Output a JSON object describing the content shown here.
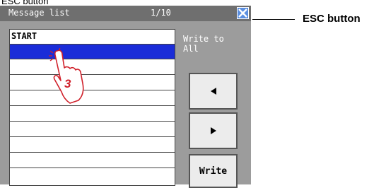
{
  "top_caption": "ESC button",
  "window": {
    "title": "Message list",
    "page_indicator": "1/10"
  },
  "list": {
    "rows": [
      {
        "text": "START",
        "selected": false
      },
      {
        "text": "",
        "selected": true
      },
      {
        "text": "",
        "selected": false
      },
      {
        "text": "",
        "selected": false
      },
      {
        "text": "",
        "selected": false
      },
      {
        "text": "",
        "selected": false
      },
      {
        "text": "",
        "selected": false
      },
      {
        "text": "",
        "selected": false
      },
      {
        "text": "",
        "selected": false
      },
      {
        "text": "",
        "selected": false
      }
    ]
  },
  "side": {
    "write_to_label_line1": "Write to",
    "write_to_label_line2": "All"
  },
  "buttons": {
    "prev_icon": "left-triangle-icon",
    "next_icon": "right-triangle-icon",
    "write_label": "Write"
  },
  "annotation": {
    "callout_label": "ESC button",
    "step_number": "3"
  },
  "colors": {
    "selected_row": "#1a2cd8",
    "esc_button": "#5b8fe0",
    "hand_outline": "#d0202a"
  }
}
